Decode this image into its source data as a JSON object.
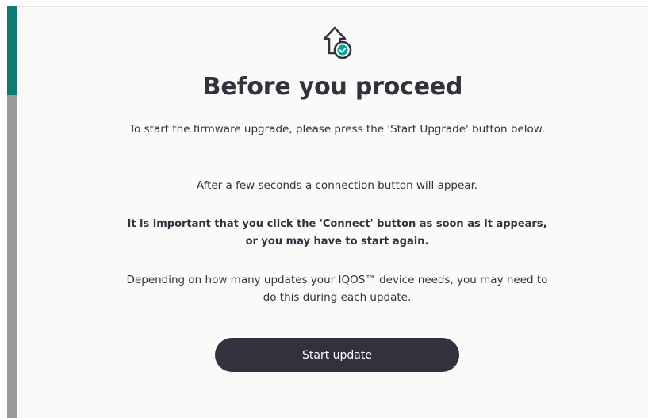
{
  "page": {
    "title": "Before you proceed",
    "paragraphs": [
      "To start the firmware upgrade, please press the 'Start Upgrade' button below.",
      "After a few seconds a connection button will appear.",
      "It is important that you click the 'Connect' button as soon as it appears, or you may have to start again.",
      "Depending on how many updates your IQOS™ device needs, you may need to do this during each update."
    ],
    "start_button_label": "Start update"
  },
  "icons": {
    "hero": "upgrade-arrow-check-icon"
  },
  "colors": {
    "text": "#34303d",
    "accent_teal": "#00a59a",
    "scroll_thumb": "#0e7c74",
    "scroll_track": "#9b9b9b",
    "button_bg": "#34303d",
    "background": "#fbfaf8"
  }
}
